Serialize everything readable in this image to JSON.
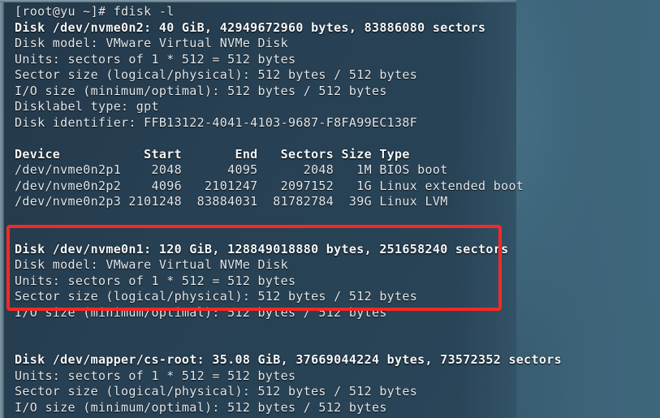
{
  "terminal": {
    "prompt_line": "[root@yu ~]# fdisk -l",
    "colors": {
      "background": "#2a4559",
      "desktop": "#3d6479",
      "text": "#e2e9ee",
      "highlight": "#f42a24"
    },
    "lines": [
      {
        "text": "[root@yu ~]# fdisk -l",
        "bold": false,
        "name": "prompt-line"
      },
      {
        "text": "Disk /dev/nvme0n2: 40 GiB, 42949672960 bytes, 83886080 sectors",
        "bold": true,
        "name": "disk-header-nvme0n2"
      },
      {
        "text": "Disk model: VMware Virtual NVMe Disk",
        "bold": false,
        "name": "disk-model-nvme0n2"
      },
      {
        "text": "Units: sectors of 1 * 512 = 512 bytes",
        "bold": false,
        "name": "units-nvme0n2"
      },
      {
        "text": "Sector size (logical/physical): 512 bytes / 512 bytes",
        "bold": false,
        "name": "sector-size-nvme0n2"
      },
      {
        "text": "I/O size (minimum/optimal): 512 bytes / 512 bytes",
        "bold": false,
        "name": "io-size-nvme0n2"
      },
      {
        "text": "Disklabel type: gpt",
        "bold": false,
        "name": "disklabel-type-nvme0n2"
      },
      {
        "text": "Disk identifier: FFB13122-4041-4103-9687-F8FA99EC138F",
        "bold": false,
        "name": "disk-identifier-nvme0n2"
      },
      {
        "text": "",
        "bold": false,
        "name": "blank-line-1"
      },
      {
        "text": "Device           Start       End   Sectors Size Type",
        "bold": true,
        "name": "partition-table-header"
      },
      {
        "text": "/dev/nvme0n2p1    2048      4095      2048   1M BIOS boot",
        "bold": false,
        "name": "partition-row-p1"
      },
      {
        "text": "/dev/nvme0n2p2    4096   2101247   2097152   1G Linux extended boot",
        "bold": false,
        "name": "partition-row-p2"
      },
      {
        "text": "/dev/nvme0n2p3 2101248  83884031  81782784  39G Linux LVM",
        "bold": false,
        "name": "partition-row-p3"
      },
      {
        "text": "",
        "bold": false,
        "name": "blank-line-2"
      },
      {
        "text": "",
        "bold": false,
        "name": "blank-line-3"
      },
      {
        "text": "Disk /dev/nvme0n1: 120 GiB, 128849018880 bytes, 251658240 sectors",
        "bold": true,
        "name": "disk-header-nvme0n1"
      },
      {
        "text": "Disk model: VMware Virtual NVMe Disk",
        "bold": false,
        "name": "disk-model-nvme0n1"
      },
      {
        "text": "Units: sectors of 1 * 512 = 512 bytes",
        "bold": false,
        "name": "units-nvme0n1"
      },
      {
        "text": "Sector size (logical/physical): 512 bytes / 512 bytes",
        "bold": false,
        "name": "sector-size-nvme0n1"
      },
      {
        "text": "I/O size (minimum/optimal): 512 bytes / 512 bytes",
        "bold": false,
        "name": "io-size-nvme0n1"
      },
      {
        "text": "",
        "bold": false,
        "name": "blank-line-4"
      },
      {
        "text": "",
        "bold": false,
        "name": "blank-line-5"
      },
      {
        "text": "Disk /dev/mapper/cs-root: 35.08 GiB, 37669044224 bytes, 73572352 sectors",
        "bold": true,
        "name": "disk-header-cs-root"
      },
      {
        "text": "Units: sectors of 1 * 512 = 512 bytes",
        "bold": false,
        "name": "units-cs-root"
      },
      {
        "text": "Sector size (logical/physical): 512 bytes / 512 bytes",
        "bold": false,
        "name": "sector-size-cs-root"
      },
      {
        "text": "I/O size (minimum/optimal): 512 bytes / 512 bytes",
        "bold": false,
        "name": "io-size-cs-root"
      }
    ],
    "partition_table": {
      "headers": [
        "Device",
        "Start",
        "End",
        "Sectors",
        "Size",
        "Type"
      ],
      "rows": [
        [
          "/dev/nvme0n2p1",
          "2048",
          "4095",
          "2048",
          "1M",
          "BIOS boot"
        ],
        [
          "/dev/nvme0n2p2",
          "4096",
          "2101247",
          "2097152",
          "1G",
          "Linux extended boot"
        ],
        [
          "/dev/nvme0n2p3",
          "2101248",
          "83884031",
          "81782784",
          "39G",
          "Linux LVM"
        ]
      ]
    },
    "disks": [
      {
        "device": "/dev/nvme0n2",
        "size": "40 GiB",
        "bytes": "42949672960",
        "sectors": "83886080",
        "model": "VMware Virtual NVMe Disk",
        "units": "sectors of 1 * 512 = 512 bytes",
        "sector_size": "512 bytes / 512 bytes",
        "io_size": "512 bytes / 512 bytes",
        "disklabel_type": "gpt",
        "identifier": "FFB13122-4041-4103-9687-F8FA99EC138F"
      },
      {
        "device": "/dev/nvme0n1",
        "size": "120 GiB",
        "bytes": "128849018880",
        "sectors": "251658240",
        "model": "VMware Virtual NVMe Disk",
        "units": "sectors of 1 * 512 = 512 bytes",
        "sector_size": "512 bytes / 512 bytes",
        "io_size": "512 bytes / 512 bytes",
        "highlighted": true
      },
      {
        "device": "/dev/mapper/cs-root",
        "size": "35.08 GiB",
        "bytes": "37669044224",
        "sectors": "73572352",
        "units": "sectors of 1 * 512 = 512 bytes",
        "sector_size": "512 bytes / 512 bytes",
        "io_size": "512 bytes / 512 bytes"
      }
    ]
  }
}
